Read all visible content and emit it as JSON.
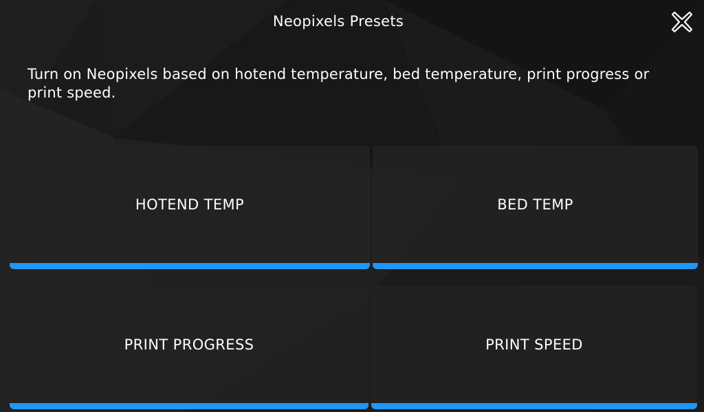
{
  "header": {
    "title": "Neopixels Presets",
    "close_icon": "close-icon"
  },
  "description": "Turn on Neopixels based on hotend temperature, bed temperature, print progress or print speed.",
  "presets": [
    {
      "label": "HOTEND TEMP"
    },
    {
      "label": "BED TEMP"
    },
    {
      "label": "PRINT PROGRESS"
    },
    {
      "label": "PRINT SPEED"
    }
  ],
  "colors": {
    "background": "#191919",
    "button": "#222222",
    "accent": "#2196f3",
    "text": "#ffffff"
  }
}
